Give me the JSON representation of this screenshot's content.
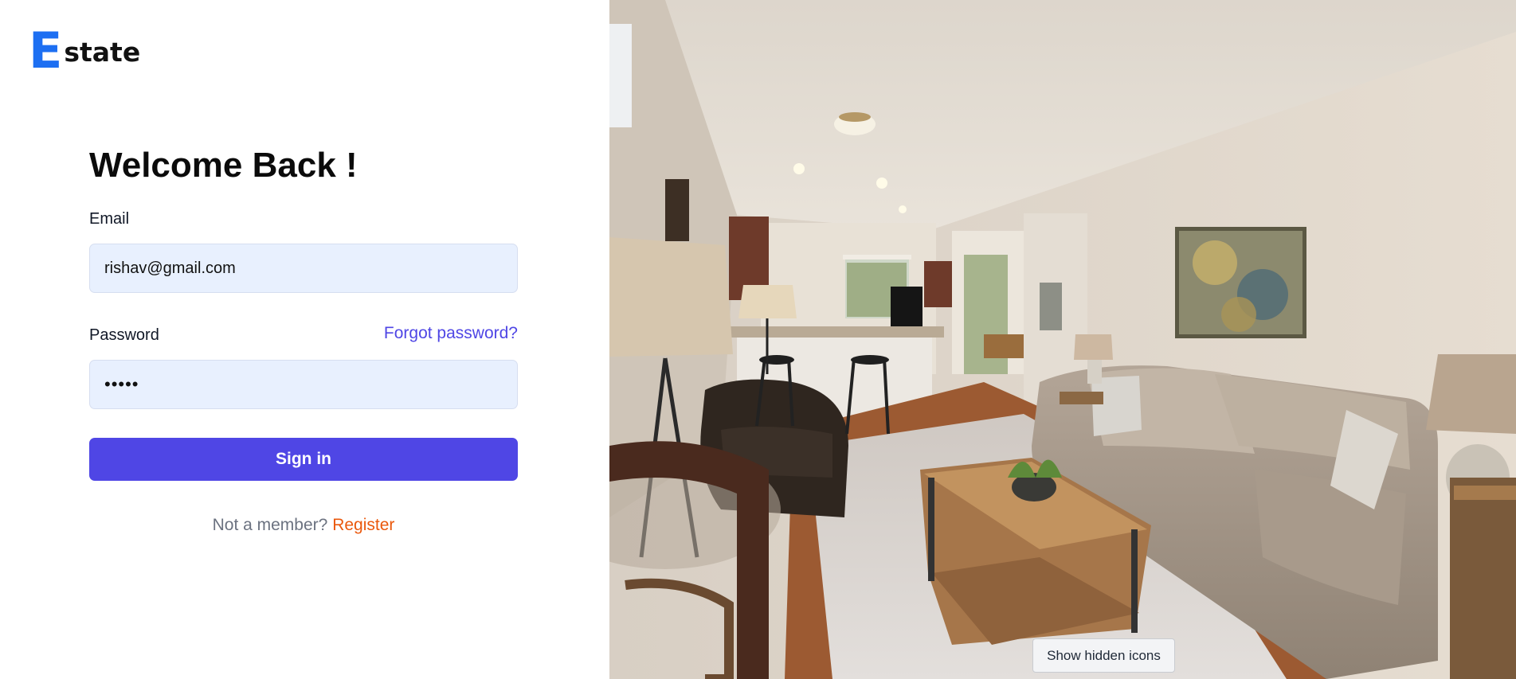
{
  "brand": {
    "mark": "E",
    "name": "state"
  },
  "login": {
    "heading": "Welcome Back !",
    "email_label": "Email",
    "email_value": "rishav@gmail.com",
    "password_label": "Password",
    "forgot_label": "Forgot password?",
    "password_value": "•••••",
    "submit_label": "Sign in",
    "member_prompt": "Not a member?",
    "register_label": "Register"
  },
  "hero": {
    "icon": "living-room-photo"
  },
  "system": {
    "tooltip_label": "Show hidden icons"
  },
  "colors": {
    "accent": "#4f46e5",
    "brand": "#1d6ff2",
    "link_orange": "#ea580c",
    "input_bg": "#e8f0fe"
  }
}
